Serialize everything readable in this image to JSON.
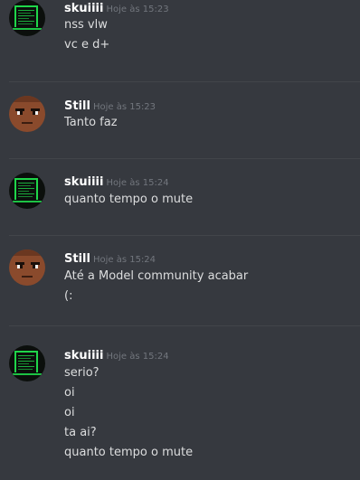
{
  "messages": [
    {
      "author": "skuiiii",
      "timestamp": "Hoje às 15:23",
      "avatar": "terminal-avatar-icon",
      "lines": [
        "nss vlw",
        "vc e d+"
      ]
    },
    {
      "author": "Still",
      "timestamp": "Hoje às 15:23",
      "avatar": "character-face-avatar-icon",
      "lines": [
        "Tanto faz"
      ]
    },
    {
      "author": "skuiiii",
      "timestamp": "Hoje às 15:24",
      "avatar": "terminal-avatar-icon",
      "lines": [
        "quanto tempo o mute"
      ]
    },
    {
      "author": "Still",
      "timestamp": "Hoje às 15:24",
      "avatar": "character-face-avatar-icon",
      "lines": [
        "Até a Model community acabar",
        "(:"
      ]
    },
    {
      "author": "skuiiii",
      "timestamp": "Hoje às 15:24",
      "avatar": "terminal-avatar-icon",
      "lines": [
        "serio?",
        "oi",
        "oi",
        "ta ai?",
        "quanto tempo o mute"
      ]
    }
  ],
  "colors": {
    "background": "#36393f",
    "username": "#ffffff",
    "timestamp": "#72767d",
    "text": "#dcddde",
    "divider": "#42454a",
    "terminal_green": "#1fd64a",
    "skin": "#8a4a2c"
  }
}
